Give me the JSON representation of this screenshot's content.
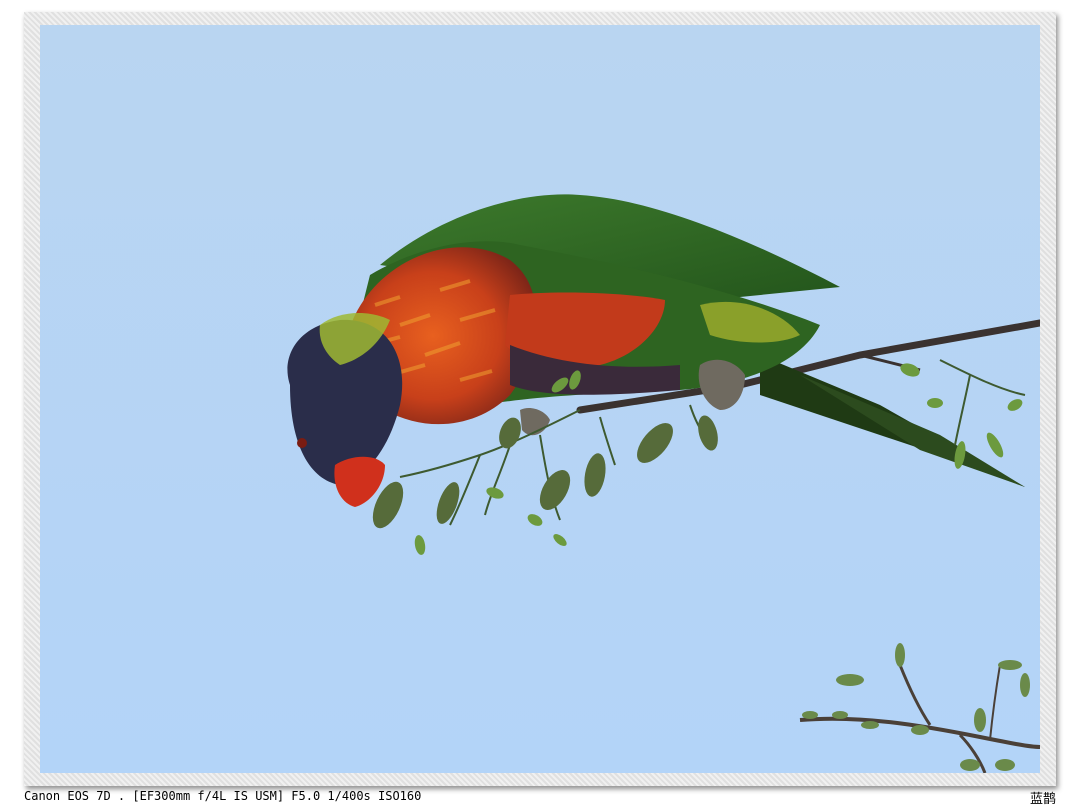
{
  "caption": {
    "camera_info": "Canon EOS 7D . [EF300mm f/4L IS USM] F5.0 1/400s ISO160",
    "author": "蓝鹊"
  },
  "photo": {
    "sky_top": "#b9d5f1",
    "sky_bottom": "#b3d4f8",
    "plumage_green": "#2f6a22",
    "plumage_orange": "#d4481a",
    "head_blue": "#2a2d4a"
  }
}
